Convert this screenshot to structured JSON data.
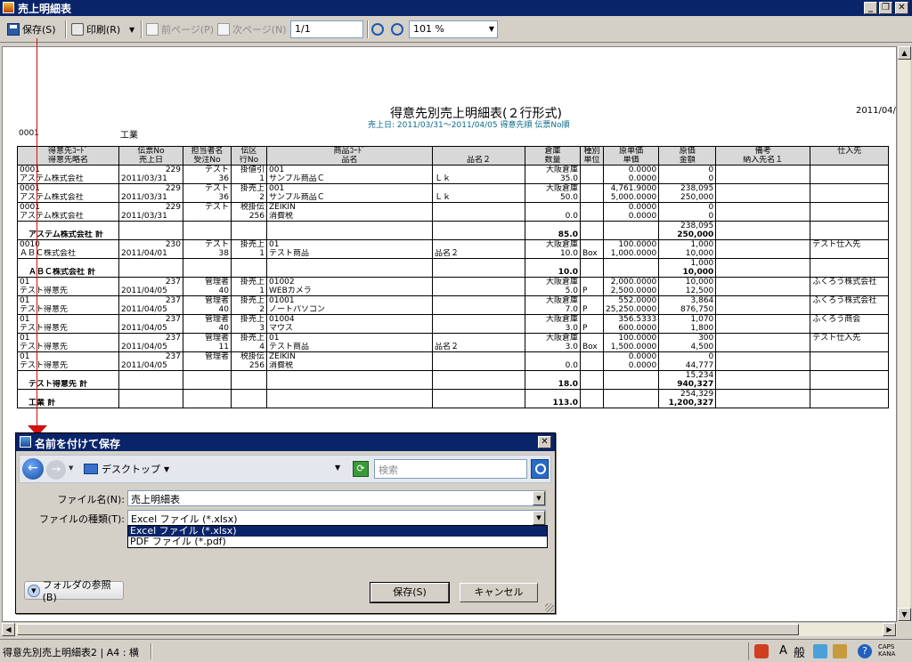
{
  "window": {
    "title": "売上明細表"
  },
  "toolbar": {
    "save_label": "保存(S)",
    "print_label": "印刷(R)",
    "prev_label": "前ページ(P)",
    "next_label": "次ページ(N)",
    "page_value": "1/1",
    "zoom_value": "101 %"
  },
  "report": {
    "title": "得意先別売上明細表(２行形式)",
    "subtitle": "売上日: 2011/03/31～2011/04/05 得意先順 伝票No順",
    "date": "2011/04/1",
    "group_code": "0001",
    "group_name": "工業",
    "header_row1": [
      "得意先ｺｰﾄﾞ",
      "伝票No",
      "担当者名",
      "伝区",
      "商品ｺｰﾄﾞ",
      "",
      "倉庫",
      "種別",
      "原単価",
      "原価",
      "備考",
      "仕入先"
    ],
    "header_row2": [
      "得意先略名",
      "売上日",
      "受注No",
      "行No",
      "品名",
      "品名２",
      "数量",
      "単位",
      "単価",
      "金額",
      "納入先名１",
      ""
    ],
    "rows": [
      {
        "a": [
          "0001",
          "229",
          "テスト",
          "掛値引",
          "001",
          "",
          "大阪倉庫",
          "",
          "0.0000",
          "0",
          "",
          ""
        ],
        "b": [
          "アステム株式会社",
          "2011/03/31",
          "36",
          "1",
          "サンプル商品Ｃ",
          "Ｌｋ",
          "35.0",
          "",
          "0.0000",
          "0",
          "",
          ""
        ]
      },
      {
        "a": [
          "0001",
          "229",
          "テスト",
          "掛売上",
          "001",
          "",
          "大阪倉庫",
          "",
          "4,761.9000",
          "238,095",
          "",
          ""
        ],
        "b": [
          "アステム株式会社",
          "2011/03/31",
          "36",
          "2",
          "サンプル商品Ｃ",
          "Ｌｋ",
          "50.0",
          "",
          "5,000.0000",
          "250,000",
          "",
          ""
        ]
      },
      {
        "a": [
          "0001",
          "229",
          "テスト",
          "税掛伝",
          "ZEIKIN",
          "",
          "",
          "",
          "0.0000",
          "0",
          "",
          ""
        ],
        "b": [
          "アステム株式会社",
          "2011/03/31",
          "",
          "256",
          "消費税",
          "",
          "0.0",
          "",
          "0.0000",
          "0",
          "",
          ""
        ]
      },
      {
        "total": true,
        "a": [
          "",
          "",
          "",
          "",
          "",
          "",
          "",
          "",
          "",
          "238,095",
          "",
          ""
        ],
        "b": [
          "アステム株式会社 計",
          "",
          "",
          "",
          "",
          "",
          "85.0",
          "",
          "",
          "250,000",
          "",
          ""
        ]
      },
      {
        "a": [
          "0010",
          "230",
          "テスト",
          "掛売上",
          "01",
          "",
          "大阪倉庫",
          "",
          "100.0000",
          "1,000",
          "",
          "テスト仕入先"
        ],
        "b": [
          "ＡＢＣ株式会社",
          "2011/04/01",
          "38",
          "1",
          "テスト商品",
          "品名２",
          "10.0",
          "Box",
          "1,000.0000",
          "10,000",
          "",
          ""
        ]
      },
      {
        "total": true,
        "a": [
          "",
          "",
          "",
          "",
          "",
          "",
          "",
          "",
          "",
          "1,000",
          "",
          ""
        ],
        "b": [
          "ＡＢＣ株式会社 計",
          "",
          "",
          "",
          "",
          "",
          "10.0",
          "",
          "",
          "10,000",
          "",
          ""
        ]
      },
      {
        "a": [
          "01",
          "237",
          "管理者",
          "掛売上",
          "01002",
          "",
          "大阪倉庫",
          "",
          "2,000.0000",
          "10,000",
          "",
          "ふくろう株式会社"
        ],
        "b": [
          "テスト得意先",
          "2011/04/05",
          "40",
          "1",
          "WEBカメラ",
          "",
          "5.0",
          "P",
          "2,500.0000",
          "12,500",
          "",
          ""
        ]
      },
      {
        "a": [
          "01",
          "237",
          "管理者",
          "掛売上",
          "01001",
          "",
          "大阪倉庫",
          "",
          "552.0000",
          "3,864",
          "",
          "ふくろう株式会社"
        ],
        "b": [
          "テスト得意先",
          "2011/04/05",
          "40",
          "2",
          "ノートパソコン",
          "",
          "7.0",
          "P",
          "25,250.0000",
          "876,750",
          "",
          ""
        ]
      },
      {
        "a": [
          "01",
          "237",
          "管理者",
          "掛売上",
          "01004",
          "",
          "大阪倉庫",
          "",
          "356.5333",
          "1,070",
          "",
          "ふくろう商会"
        ],
        "b": [
          "テスト得意先",
          "2011/04/05",
          "40",
          "3",
          "マウス",
          "",
          "3.0",
          "P",
          "600.0000",
          "1,800",
          "",
          ""
        ]
      },
      {
        "a": [
          "01",
          "237",
          "管理者",
          "掛売上",
          "01",
          "",
          "大阪倉庫",
          "",
          "100.0000",
          "300",
          "",
          "テスト仕入先"
        ],
        "b": [
          "テスト得意先",
          "2011/04/05",
          "11",
          "4",
          "テスト商品",
          "品名２",
          "3.0",
          "Box",
          "1,500.0000",
          "4,500",
          "",
          ""
        ]
      },
      {
        "a": [
          "01",
          "237",
          "管理者",
          "税掛伝",
          "ZEIKIN",
          "",
          "",
          "",
          "0.0000",
          "0",
          "",
          ""
        ],
        "b": [
          "テスト得意先",
          "2011/04/05",
          "",
          "256",
          "消費税",
          "",
          "0.0",
          "",
          "0.0000",
          "44,777",
          "",
          ""
        ]
      },
      {
        "total": true,
        "a": [
          "",
          "",
          "",
          "",
          "",
          "",
          "",
          "",
          "",
          "15,234",
          "",
          ""
        ],
        "b": [
          "テスト得意先 計",
          "",
          "",
          "",
          "",
          "",
          "18.0",
          "",
          "",
          "940,327",
          "",
          ""
        ]
      },
      {
        "total": true,
        "grand": true,
        "a": [
          "",
          "",
          "",
          "",
          "",
          "",
          "",
          "",
          "",
          "254,329",
          "",
          ""
        ],
        "b": [
          "工業 計",
          "",
          "",
          "",
          "",
          "",
          "113.0",
          "",
          "",
          "1,200,327",
          "",
          ""
        ]
      }
    ]
  },
  "dialog": {
    "title": "名前を付けて保存",
    "location": "デスクトップ",
    "search_placeholder": "検索",
    "filename_label": "ファイル名(N):",
    "filename_value": "売上明細表",
    "filetype_label": "ファイルの種類(T):",
    "filetype_value": "Excel ファイル (*.xlsx)",
    "filetype_options": [
      "Excel ファイル (*.xlsx)",
      "PDF ファイル (*.pdf)"
    ],
    "browse_label": "フォルダの参照(B)",
    "save_label": "保存(S)",
    "cancel_label": "キャンセル"
  },
  "statusbar": {
    "report_name": "得意先別売上明細表2",
    "paper": "A4 : 横",
    "ime_mode": "般",
    "caps": "CAPS",
    "kana": "KANA"
  },
  "colors": {
    "titlebar": "#0a246a",
    "annotation": "#d01010",
    "subtitle": "#0a6a8a"
  }
}
